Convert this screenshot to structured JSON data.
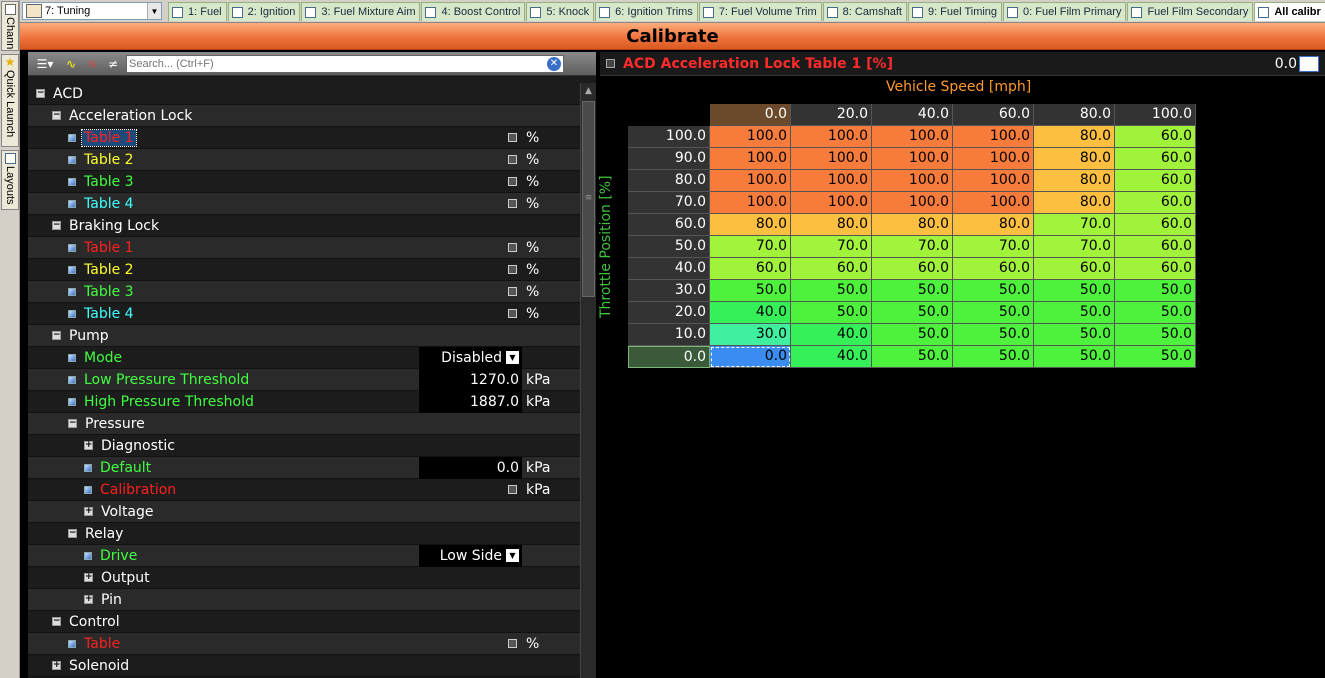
{
  "sidebar": {
    "tabs": [
      {
        "label": "Channels",
        "icon": "channels-icon"
      },
      {
        "label": "Quick Launch",
        "icon": "star-icon"
      },
      {
        "label": "Layouts",
        "icon": "layouts-icon"
      }
    ]
  },
  "workspace": {
    "selected": "7: Tuning"
  },
  "tabs": [
    {
      "label": "1: Fuel"
    },
    {
      "label": "2: Ignition"
    },
    {
      "label": "3: Fuel Mixture Aim"
    },
    {
      "label": "4: Boost Control"
    },
    {
      "label": "5: Knock"
    },
    {
      "label": "6: Ignition Trims"
    },
    {
      "label": "7: Fuel Volume Trim"
    },
    {
      "label": "8: Camshaft"
    },
    {
      "label": "9: Fuel Timing"
    },
    {
      "label": "0: Fuel Film Primary"
    },
    {
      "label": "Fuel Film Secondary"
    },
    {
      "label": "All calibr"
    }
  ],
  "header": {
    "title": "Calibrate"
  },
  "tree": {
    "search_placeholder": "Search... (Ctrl+F)",
    "rows": [
      {
        "label": "ACD",
        "level": 0,
        "type": "group",
        "toggle": "−",
        "color": "#ffffff"
      },
      {
        "label": "Acceleration Lock",
        "level": 1,
        "type": "group",
        "toggle": "−",
        "color": "#ffffff"
      },
      {
        "label": "Table 1",
        "level": 2,
        "type": "table",
        "color": "#ff2020",
        "unit": "%",
        "selected": true
      },
      {
        "label": "Table 2",
        "level": 2,
        "type": "table",
        "color": "#ffff30",
        "unit": "%"
      },
      {
        "label": "Table 3",
        "level": 2,
        "type": "table",
        "color": "#40ff40",
        "unit": "%"
      },
      {
        "label": "Table 4",
        "level": 2,
        "type": "table",
        "color": "#40ffff",
        "unit": "%"
      },
      {
        "label": "Braking Lock",
        "level": 1,
        "type": "group",
        "toggle": "−",
        "color": "#ffffff"
      },
      {
        "label": "Table 1",
        "level": 2,
        "type": "table",
        "color": "#ff2020",
        "unit": "%"
      },
      {
        "label": "Table 2",
        "level": 2,
        "type": "table",
        "color": "#ffff30",
        "unit": "%"
      },
      {
        "label": "Table 3",
        "level": 2,
        "type": "table",
        "color": "#40ff40",
        "unit": "%"
      },
      {
        "label": "Table 4",
        "level": 2,
        "type": "table",
        "color": "#40ffff",
        "unit": "%"
      },
      {
        "label": "Pump",
        "level": 1,
        "type": "group",
        "toggle": "−",
        "color": "#ffffff"
      },
      {
        "label": "Mode",
        "level": 2,
        "type": "dropdown",
        "color": "#40ff40",
        "value": "Disabled"
      },
      {
        "label": "Low Pressure Threshold",
        "level": 2,
        "type": "value",
        "color": "#40ff40",
        "value": "1270.0",
        "unit": "kPa"
      },
      {
        "label": "High Pressure Threshold",
        "level": 2,
        "type": "value",
        "color": "#40ff40",
        "value": "1887.0",
        "unit": "kPa"
      },
      {
        "label": "Pressure",
        "level": 2,
        "type": "group",
        "toggle": "−",
        "color": "#ffffff"
      },
      {
        "label": "Diagnostic",
        "level": 3,
        "type": "group",
        "toggle": "+",
        "color": "#ffffff"
      },
      {
        "label": "Default",
        "level": 3,
        "type": "value",
        "color": "#40ff40",
        "value": "0.0",
        "unit": "kPa"
      },
      {
        "label": "Calibration",
        "level": 3,
        "type": "table",
        "color": "#ff2020",
        "unit": "kPa"
      },
      {
        "label": "Voltage",
        "level": 3,
        "type": "group",
        "toggle": "+",
        "color": "#ffffff"
      },
      {
        "label": "Relay",
        "level": 2,
        "type": "group",
        "toggle": "−",
        "color": "#ffffff"
      },
      {
        "label": "Drive",
        "level": 3,
        "type": "dropdown",
        "color": "#40ff40",
        "value": "Low Side"
      },
      {
        "label": "Output",
        "level": 3,
        "type": "group",
        "toggle": "+",
        "color": "#ffffff"
      },
      {
        "label": "Pin",
        "level": 3,
        "type": "group",
        "toggle": "+",
        "color": "#ffffff"
      },
      {
        "label": "Control",
        "level": 1,
        "type": "group",
        "toggle": "−",
        "color": "#ffffff"
      },
      {
        "label": "Table",
        "level": 2,
        "type": "table",
        "color": "#ff2020",
        "unit": "%"
      },
      {
        "label": "Solenoid",
        "level": 1,
        "type": "group",
        "toggle": "+",
        "color": "#ffffff"
      }
    ]
  },
  "grid": {
    "title": "ACD Acceleration Lock Table 1 [%]",
    "current_value": "0.0",
    "x_axis_label": "Vehicle Speed [mph]",
    "y_axis_label": "Throttle Position [%]",
    "x_values": [
      "0.0",
      "20.0",
      "40.0",
      "60.0",
      "80.0",
      "100.0"
    ],
    "y_values": [
      "100.0",
      "90.0",
      "80.0",
      "70.0",
      "60.0",
      "50.0",
      "40.0",
      "30.0",
      "20.0",
      "10.0",
      "0.0"
    ],
    "cells": [
      [
        "100.0",
        "100.0",
        "100.0",
        "100.0",
        "80.0",
        "60.0"
      ],
      [
        "100.0",
        "100.0",
        "100.0",
        "100.0",
        "80.0",
        "60.0"
      ],
      [
        "100.0",
        "100.0",
        "100.0",
        "100.0",
        "80.0",
        "60.0"
      ],
      [
        "100.0",
        "100.0",
        "100.0",
        "100.0",
        "80.0",
        "60.0"
      ],
      [
        "80.0",
        "80.0",
        "80.0",
        "80.0",
        "70.0",
        "60.0"
      ],
      [
        "70.0",
        "70.0",
        "70.0",
        "70.0",
        "70.0",
        "60.0"
      ],
      [
        "60.0",
        "60.0",
        "60.0",
        "60.0",
        "60.0",
        "60.0"
      ],
      [
        "50.0",
        "50.0",
        "50.0",
        "50.0",
        "50.0",
        "50.0"
      ],
      [
        "40.0",
        "50.0",
        "50.0",
        "50.0",
        "50.0",
        "50.0"
      ],
      [
        "30.0",
        "40.0",
        "50.0",
        "50.0",
        "50.0",
        "50.0"
      ],
      [
        "0.0",
        "40.0",
        "50.0",
        "50.0",
        "50.0",
        "50.0"
      ]
    ],
    "selected_cell": [
      10,
      0
    ],
    "value_colors": {
      "100.0": "#f77b3a",
      "80.0": "#fdbf40",
      "70.0": "#a2f43a",
      "60.0": "#a0f23a",
      "50.0": "#4ef23c",
      "40.0": "#36f05a",
      "30.0": "#40f0a0",
      "0.0": "#3a8cf0"
    }
  }
}
